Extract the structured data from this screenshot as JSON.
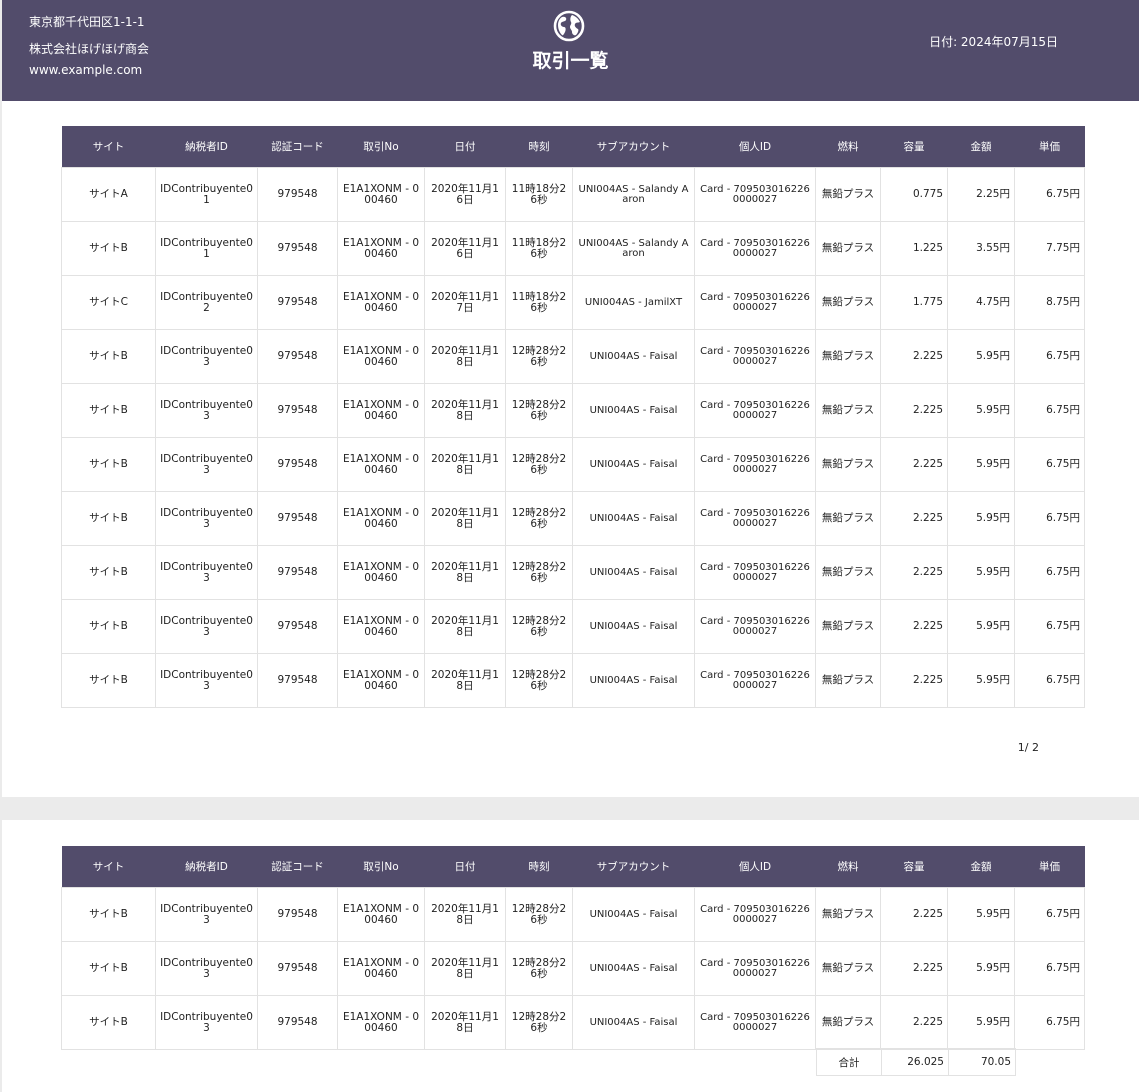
{
  "header": {
    "address": "東京都千代田区1-1-1",
    "company": "株式会社ほげほげ商会",
    "website": "www.example.com",
    "title": "取引一覧",
    "date_label": "日付: 2024年07月15日",
    "logo_icon": "globe-icon"
  },
  "columns": [
    "サイト",
    "納税者ID",
    "認証コード",
    "取引No",
    "日付",
    "時刻",
    "サブアカウント",
    "個人ID",
    "燃料",
    "容量",
    "金額",
    "単価"
  ],
  "page1_rows": [
    [
      "サイトA",
      "IDContribuyente01",
      "979548",
      "E1A1XONM - 000460",
      "2020年11月16日",
      "11時18分26秒",
      "UNI004AS - Salandy Aaron",
      "Card - 7095030162260000027",
      "無鉛プラス",
      "0.775",
      "2.25円",
      "6.75円"
    ],
    [
      "サイトB",
      "IDContribuyente01",
      "979548",
      "E1A1XONM - 000460",
      "2020年11月16日",
      "11時18分26秒",
      "UNI004AS - Salandy Aaron",
      "Card - 7095030162260000027",
      "無鉛プラス",
      "1.225",
      "3.55円",
      "7.75円"
    ],
    [
      "サイトC",
      "IDContribuyente02",
      "979548",
      "E1A1XONM - 000460",
      "2020年11月17日",
      "11時18分26秒",
      "UNI004AS - JamilXT",
      "Card - 7095030162260000027",
      "無鉛プラス",
      "1.775",
      "4.75円",
      "8.75円"
    ],
    [
      "サイトB",
      "IDContribuyente03",
      "979548",
      "E1A1XONM - 000460",
      "2020年11月18日",
      "12時28分26秒",
      "UNI004AS - Faisal",
      "Card - 7095030162260000027",
      "無鉛プラス",
      "2.225",
      "5.95円",
      "6.75円"
    ],
    [
      "サイトB",
      "IDContribuyente03",
      "979548",
      "E1A1XONM - 000460",
      "2020年11月18日",
      "12時28分26秒",
      "UNI004AS - Faisal",
      "Card - 7095030162260000027",
      "無鉛プラス",
      "2.225",
      "5.95円",
      "6.75円"
    ],
    [
      "サイトB",
      "IDContribuyente03",
      "979548",
      "E1A1XONM - 000460",
      "2020年11月18日",
      "12時28分26秒",
      "UNI004AS - Faisal",
      "Card - 7095030162260000027",
      "無鉛プラス",
      "2.225",
      "5.95円",
      "6.75円"
    ],
    [
      "サイトB",
      "IDContribuyente03",
      "979548",
      "E1A1XONM - 000460",
      "2020年11月18日",
      "12時28分26秒",
      "UNI004AS - Faisal",
      "Card - 7095030162260000027",
      "無鉛プラス",
      "2.225",
      "5.95円",
      "6.75円"
    ],
    [
      "サイトB",
      "IDContribuyente03",
      "979548",
      "E1A1XONM - 000460",
      "2020年11月18日",
      "12時28分26秒",
      "UNI004AS - Faisal",
      "Card - 7095030162260000027",
      "無鉛プラス",
      "2.225",
      "5.95円",
      "6.75円"
    ],
    [
      "サイトB",
      "IDContribuyente03",
      "979548",
      "E1A1XONM - 000460",
      "2020年11月18日",
      "12時28分26秒",
      "UNI004AS - Faisal",
      "Card - 7095030162260000027",
      "無鉛プラス",
      "2.225",
      "5.95円",
      "6.75円"
    ],
    [
      "サイトB",
      "IDContribuyente03",
      "979548",
      "E1A1XONM - 000460",
      "2020年11月18日",
      "12時28分26秒",
      "UNI004AS - Faisal",
      "Card - 7095030162260000027",
      "無鉛プラス",
      "2.225",
      "5.95円",
      "6.75円"
    ]
  ],
  "page1_pager": "1/ 2",
  "page2_rows": [
    [
      "サイトB",
      "IDContribuyente03",
      "979548",
      "E1A1XONM - 000460",
      "2020年11月18日",
      "12時28分26秒",
      "UNI004AS - Faisal",
      "Card - 7095030162260000027",
      "無鉛プラス",
      "2.225",
      "5.95円",
      "6.75円"
    ],
    [
      "サイトB",
      "IDContribuyente03",
      "979548",
      "E1A1XONM - 000460",
      "2020年11月18日",
      "12時28分26秒",
      "UNI004AS - Faisal",
      "Card - 7095030162260000027",
      "無鉛プラス",
      "2.225",
      "5.95円",
      "6.75円"
    ],
    [
      "サイトB",
      "IDContribuyente03",
      "979548",
      "E1A1XONM - 000460",
      "2020年11月18日",
      "12時28分26秒",
      "UNI004AS - Faisal",
      "Card - 7095030162260000027",
      "無鉛プラス",
      "2.225",
      "5.95円",
      "6.75円"
    ]
  ],
  "totals": {
    "label": "合計",
    "volume": "26.025",
    "amount": "70.05"
  }
}
